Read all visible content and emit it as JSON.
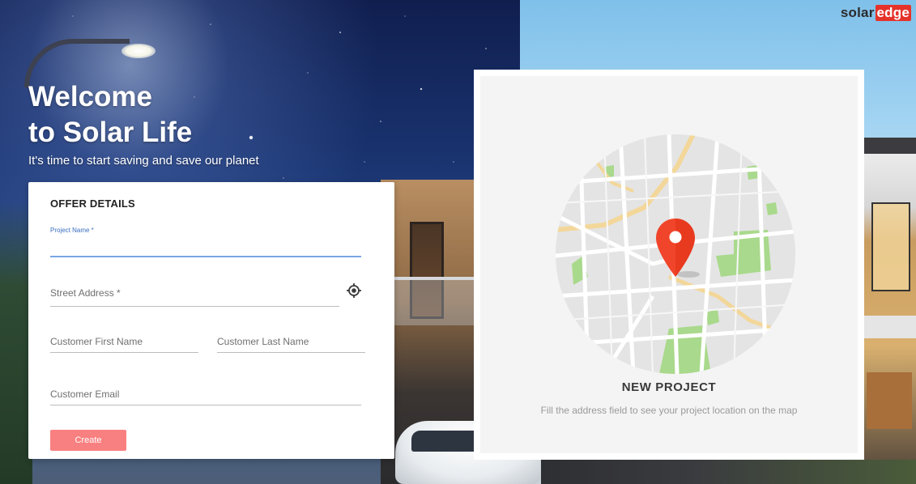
{
  "brand": {
    "logo_text_a": "solar",
    "logo_text_b": "edge"
  },
  "hero": {
    "title": "Welcome\nto Solar Life",
    "subtitle": "It's time to start saving and save our planet"
  },
  "form": {
    "title": "OFFER DETAILS",
    "project_name": {
      "label": "Project Name *",
      "value": ""
    },
    "street_address": {
      "label": "Street Address *",
      "value": ""
    },
    "first_name": {
      "label": "Customer First Name",
      "value": ""
    },
    "last_name": {
      "label": "Customer Last Name",
      "value": ""
    },
    "email": {
      "label": "Customer Email",
      "value": ""
    },
    "create_label": "Create",
    "locate_icon": "my-location-icon"
  },
  "map": {
    "title": "NEW PROJECT",
    "subtitle": "Fill the address field to see your project location on the map",
    "pin_icon": "map-pin-icon"
  },
  "colors": {
    "accent": "#f98080",
    "active_field": "#7aa6e6",
    "pin": "#f0452b",
    "logo_edge": "#e5332a"
  }
}
